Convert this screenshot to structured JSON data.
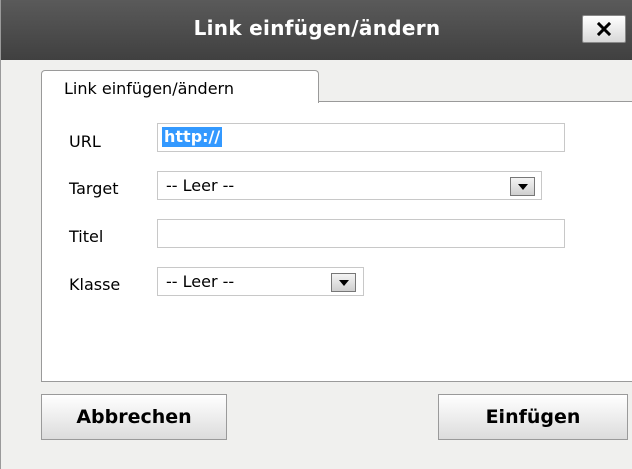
{
  "dialog": {
    "title": "Link einfügen/ändern",
    "close_icon": "close-icon"
  },
  "tabs": [
    {
      "label": "Link einfügen/ändern",
      "active": true
    }
  ],
  "form": {
    "url": {
      "label": "URL",
      "value": "http://"
    },
    "target": {
      "label": "Target",
      "selected": "-- Leer --"
    },
    "titel": {
      "label": "Titel",
      "value": ""
    },
    "klasse": {
      "label": "Klasse",
      "selected": "-- Leer --"
    }
  },
  "buttons": {
    "cancel_label": "Abbrechen",
    "insert_label": "Einfügen"
  },
  "colors": {
    "titlebar": "#4e4e4e",
    "selection": "#3399ff",
    "dialog_bg": "#f0f0ee"
  }
}
